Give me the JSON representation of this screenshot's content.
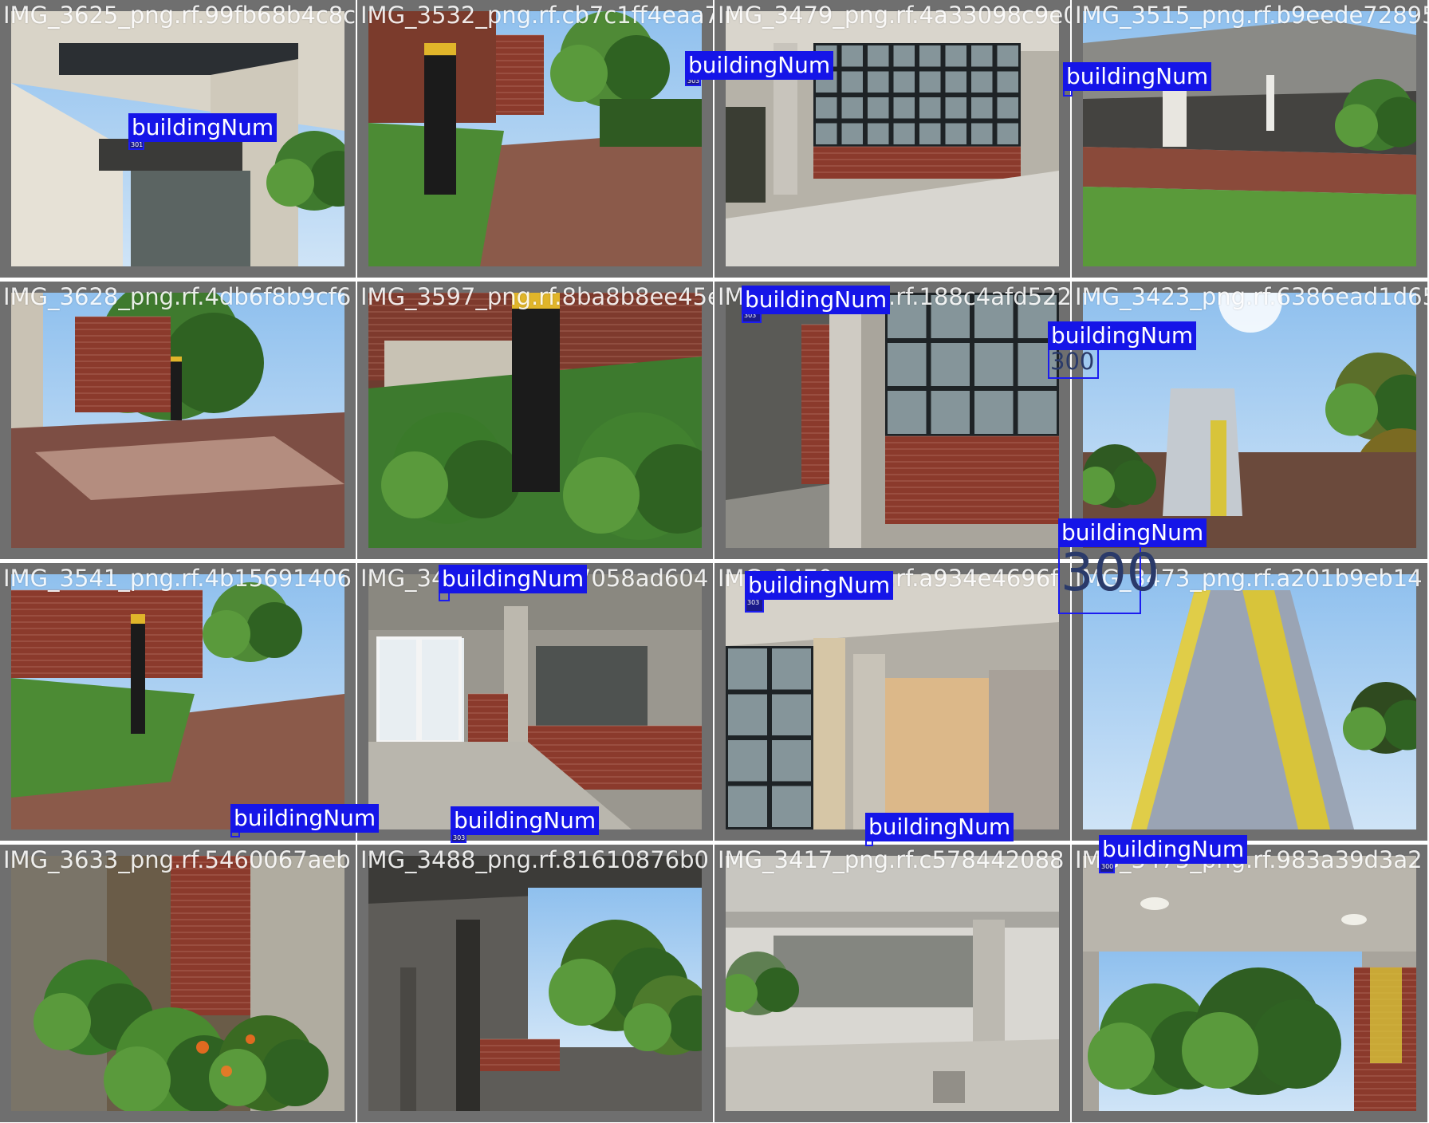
{
  "grid": {
    "rows": 4,
    "cols": 4,
    "colors": {
      "frame": "#6f6f6f",
      "label_bg": "#1515e8",
      "label_text": "#ffffff",
      "box": "#1c1cf0"
    },
    "images": [
      {
        "filename": "IMG_3625_png.rf.99fb68b4c8c5fcc55f0fag",
        "detections": [
          {
            "label": "buildingNum",
            "plate": "301"
          }
        ],
        "scene": "concrete-entrance"
      },
      {
        "filename": "IMG_3532_png.rf.cb7c1ff4eaa7b",
        "detections": [],
        "scene": "signpost-path"
      },
      {
        "filename": "IMG_3479_png.rf.4a33098c9e0",
        "detections": [
          {
            "label": "buildingNum",
            "plate": "303"
          }
        ],
        "scene": "window-wall"
      },
      {
        "filename": "IMG_3515_png.rf.b9eede72895",
        "detections": [
          {
            "label": "buildingNum",
            "plate": ""
          }
        ],
        "scene": "block-wall-lawn"
      },
      {
        "filename": "IMG_3628_png.rf.4db6f8b9cf6",
        "detections": [],
        "scene": "courtyard"
      },
      {
        "filename": "IMG_3597_png.rf.8ba8b8ee45e",
        "detections": [],
        "scene": "signpost-closeup"
      },
      {
        "filename": "IMG_3412_png.rf.188c4afd522",
        "detections": [
          {
            "label": "buildingNum",
            "plate": "303"
          }
        ],
        "scene": "window-corridor"
      },
      {
        "filename": "IMG_3423_png.rf.6386ead1d65",
        "detections": [
          {
            "label": "buildingNum",
            "plate": "300"
          }
        ],
        "scene": "tower-sky"
      },
      {
        "filename": "IMG_3541_png.rf.4b15691406",
        "detections": [],
        "scene": "signpost-path-wide"
      },
      {
        "filename": "IMG_3429_png.rf.47058ad604",
        "detections": [
          {
            "label": "buildingNum",
            "plate": ""
          }
        ],
        "scene": "glass-doors"
      },
      {
        "filename": "IMG_3470_png.rf.a934e4696f",
        "detections": [
          {
            "label": "buildingNum",
            "plate": "303"
          }
        ],
        "scene": "breezeblock"
      },
      {
        "filename": "IMG_3473_png.rf.a201b9eb14",
        "detections": [
          {
            "label": "buildingNum",
            "plate": "300"
          }
        ],
        "scene": "tower-closeup"
      },
      {
        "filename": "IMG_3633_png.rf.5460067aeb",
        "detections": [
          {
            "label": "buildingNum",
            "plate": ""
          }
        ],
        "scene": "garden-brick"
      },
      {
        "filename": "IMG_3488_png.rf.81610876b0",
        "detections": [
          {
            "label": "buildingNum",
            "plate": "303"
          }
        ],
        "scene": "undercroft-trees"
      },
      {
        "filename": "IMG_3417_png.rf.c578442088",
        "detections": [
          {
            "label": "buildingNum",
            "plate": ""
          }
        ],
        "scene": "hazy-entrance"
      },
      {
        "filename": "IMG_3475_png.rf.983a39d3a2",
        "detections": [
          {
            "label": "buildingNum",
            "plate": "300"
          }
        ],
        "scene": "overhang-trees"
      }
    ]
  }
}
